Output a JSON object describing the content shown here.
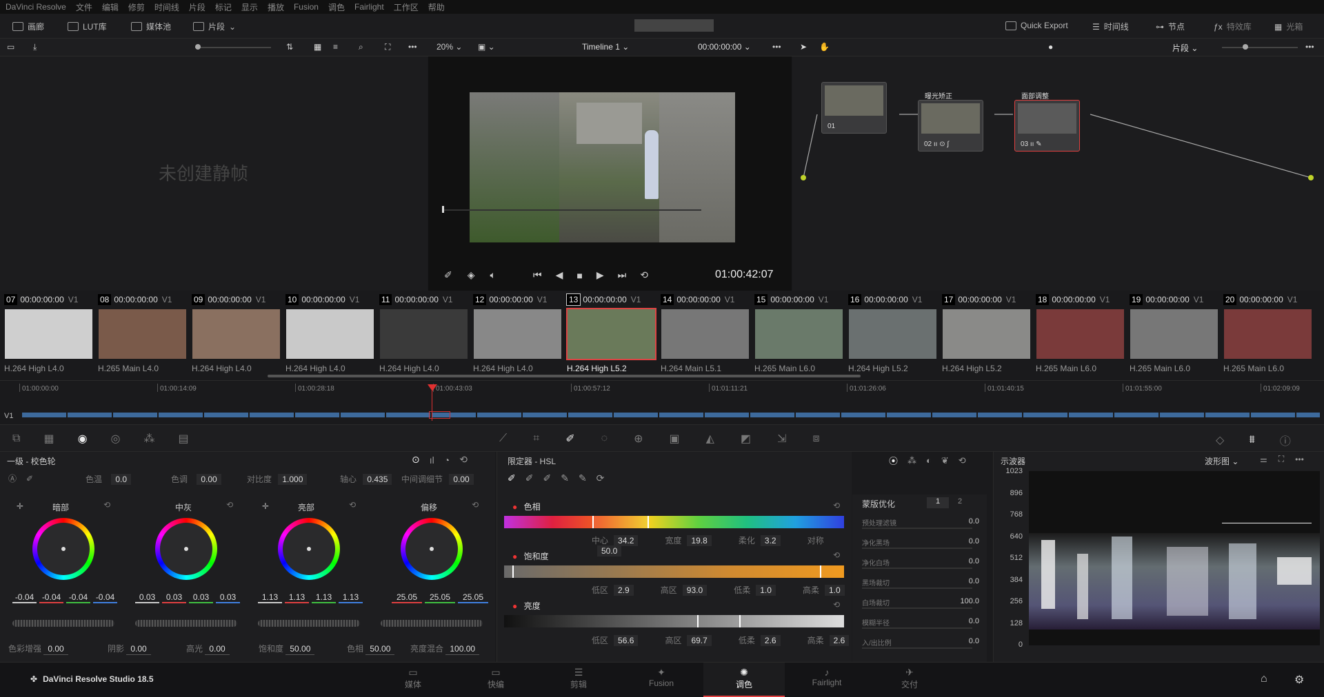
{
  "menu": [
    "DaVinci Resolve",
    "文件",
    "编辑",
    "修剪",
    "时间线",
    "片段",
    "标记",
    "显示",
    "播放",
    "Fusion",
    "调色",
    "Fairlight",
    "工作区",
    "帮助"
  ],
  "topbar": {
    "gallery": "画廊",
    "lut": "LUT库",
    "media": "媒体池",
    "clips": "片段",
    "quick_export": "Quick Export",
    "timeline": "时间线",
    "nodes": "节点",
    "effects": "特效库",
    "lightbox": "光箱"
  },
  "subbar": {
    "zoom": "20%",
    "timeline_name": "Timeline 1",
    "timecode": "00:00:00:00",
    "clips_dropdown": "片段"
  },
  "gallery": {
    "empty_text": "未创建静帧"
  },
  "viewer": {
    "timecode": "01:00:42:07"
  },
  "nodes": [
    {
      "num": "01",
      "label": ""
    },
    {
      "num": "02",
      "label": "曝光矫正"
    },
    {
      "num": "03",
      "label": "面部调整"
    }
  ],
  "clips": [
    {
      "num": "07",
      "tc": "00:00:00:00",
      "track": "V1",
      "codec": "H.264 High L4.0",
      "color": "#cfcfcf"
    },
    {
      "num": "08",
      "tc": "00:00:00:00",
      "track": "V1",
      "codec": "H.265 Main L4.0",
      "color": "#7a5a4a"
    },
    {
      "num": "09",
      "tc": "00:00:00:00",
      "track": "V1",
      "codec": "H.264 High L4.0",
      "color": "#8a7060"
    },
    {
      "num": "10",
      "tc": "00:00:00:00",
      "track": "V1",
      "codec": "H.264 High L4.0",
      "color": "#c9c9c9"
    },
    {
      "num": "11",
      "tc": "00:00:00:00",
      "track": "V1",
      "codec": "H.264 High L4.0",
      "color": "#3a3a3a"
    },
    {
      "num": "12",
      "tc": "00:00:00:00",
      "track": "V1",
      "codec": "H.264 High L4.0",
      "color": "#888888"
    },
    {
      "num": "13",
      "tc": "00:00:00:00",
      "track": "V1",
      "codec": "H.264 High L5.2",
      "color": "#6a7a5a"
    },
    {
      "num": "14",
      "tc": "00:00:00:00",
      "track": "V1",
      "codec": "H.264 Main L5.1",
      "color": "#777777"
    },
    {
      "num": "15",
      "tc": "00:00:00:00",
      "track": "V1",
      "codec": "H.265 Main L6.0",
      "color": "#6a7a6a"
    },
    {
      "num": "16",
      "tc": "00:00:00:00",
      "track": "V1",
      "codec": "H.264 High L5.2",
      "color": "#6a7070"
    },
    {
      "num": "17",
      "tc": "00:00:00:00",
      "track": "V1",
      "codec": "H.264 High L5.2",
      "color": "#8a8a88"
    },
    {
      "num": "18",
      "tc": "00:00:00:00",
      "track": "V1",
      "codec": "H.265 Main L6.0",
      "color": "#7a3a3a"
    },
    {
      "num": "19",
      "tc": "00:00:00:00",
      "track": "V1",
      "codec": "H.265 Main L6.0",
      "color": "#777777"
    },
    {
      "num": "20",
      "tc": "00:00:00:00",
      "track": "V1",
      "codec": "H.265 Main L6.0",
      "color": "#7a3a3a"
    }
  ],
  "timeline": {
    "ruler": [
      "01:00:00:00",
      "01:00:14:09",
      "01:00:28:18",
      "01:00:43:03",
      "01:00:57:12",
      "01:01:11:21",
      "01:01:26:06",
      "01:01:40:15",
      "01:01:55:00",
      "01:02:09:09"
    ],
    "track": "V1"
  },
  "wheels_panel": {
    "title": "一级 - 校色轮",
    "temp_label": "色温",
    "temp_val": "0.0",
    "tint_label": "色调",
    "tint_val": "0.00",
    "contrast_label": "对比度",
    "contrast_val": "1.000",
    "pivot_label": "轴心",
    "pivot_val": "0.435",
    "mid_detail_label": "中间调细节",
    "mid_detail_val": "0.00",
    "wheels": [
      {
        "name": "暗部",
        "vals": [
          "-0.04",
          "-0.04",
          "-0.04",
          "-0.04"
        ]
      },
      {
        "name": "中灰",
        "vals": [
          "0.03",
          "0.03",
          "0.03",
          "0.03"
        ]
      },
      {
        "name": "亮部",
        "vals": [
          "1.13",
          "1.13",
          "1.13",
          "1.13"
        ]
      },
      {
        "name": "偏移",
        "vals": [
          "25.05",
          "25.05",
          "25.05"
        ]
      }
    ],
    "bottom": {
      "color_boost_label": "色彩增强",
      "color_boost_val": "0.00",
      "shadows_label": "阴影",
      "shadows_val": "0.00",
      "highlights_label": "高光",
      "highlights_val": "0.00",
      "sat_label": "饱和度",
      "sat_val": "50.00",
      "hue_label": "色相",
      "hue_val": "50.00",
      "lummix_label": "亮度混合",
      "lummix_val": "100.00"
    }
  },
  "qualifier": {
    "title": "限定器 - HSL",
    "hue_label": "色相",
    "hue": {
      "center_label": "中心",
      "center": "34.2",
      "width_label": "宽度",
      "width": "19.8",
      "soft_label": "柔化",
      "soft": "3.2",
      "sym_label": "对称",
      "sym": "50.0"
    },
    "sat_label": "饱和度",
    "sat": {
      "low_label": "低区",
      "low": "2.9",
      "high_label": "高区",
      "high": "93.0",
      "lsoft_label": "低柔",
      "lsoft": "1.0",
      "hsoft_label": "高柔",
      "hsoft": "1.0"
    },
    "lum_label": "亮度",
    "lum": {
      "low_label": "低区",
      "low": "56.6",
      "high_label": "高区",
      "high": "69.7",
      "lsoft_label": "低柔",
      "lsoft": "2.6",
      "hsoft_label": "高柔",
      "hsoft": "2.6"
    }
  },
  "matte": {
    "title": "蒙版优化",
    "tab1": "1",
    "tab2": "2",
    "rows": [
      {
        "label": "预处理滤镜",
        "val": "0.0"
      },
      {
        "label": "净化黑场",
        "val": "0.0"
      },
      {
        "label": "净化白场",
        "val": "0.0"
      },
      {
        "label": "黑场裁切",
        "val": "0.0"
      },
      {
        "label": "白场裁切",
        "val": "100.0"
      },
      {
        "label": "模糊半径",
        "val": "0.0"
      },
      {
        "label": "入/出比例",
        "val": "0.0"
      }
    ]
  },
  "scope": {
    "title": "示波器",
    "mode": "波形图",
    "ticks": [
      "1023",
      "896",
      "768",
      "640",
      "512",
      "384",
      "256",
      "128",
      "0"
    ]
  },
  "bottom": {
    "app": "DaVinci Resolve Studio 18.5",
    "pages": [
      "媒体",
      "快编",
      "剪辑",
      "Fusion",
      "调色",
      "Fairlight",
      "交付"
    ],
    "active": "调色"
  }
}
